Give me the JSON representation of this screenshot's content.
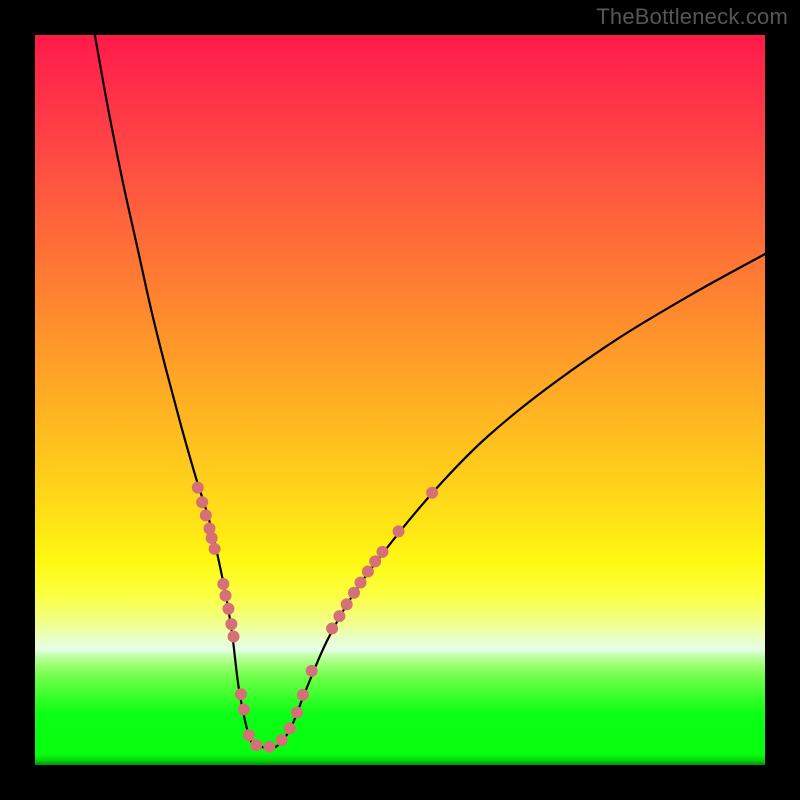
{
  "watermark": "TheBottleneck.com",
  "colors": {
    "background": "#000000",
    "curve": "#000000",
    "marker": "#d67077",
    "gradient_top": "#ff1a4a",
    "gradient_bottom": "#028e08"
  },
  "chart_data": {
    "type": "line",
    "title": "",
    "xlabel": "",
    "ylabel": "",
    "xlim": [
      0,
      100
    ],
    "ylim": [
      0,
      100
    ],
    "grid": false,
    "legend": false,
    "series": [
      {
        "name": "curve",
        "x": [
          8.2,
          10.0,
          12.0,
          14.0,
          16.0,
          18.0,
          20.0,
          22.0,
          24.0,
          26.0,
          27.0,
          28.0,
          29.5,
          31.0,
          33.0,
          35.0,
          37.0,
          40.0,
          44.0,
          50.0,
          56.0,
          62.0,
          70.0,
          80.0,
          90.0,
          100.0
        ],
        "y": [
          100.0,
          90.0,
          80.0,
          71.0,
          62.0,
          54.0,
          46.5,
          39.5,
          33.0,
          24.0,
          18.0,
          10.0,
          3.5,
          2.5,
          2.5,
          5.0,
          10.0,
          17.0,
          24.0,
          32.0,
          39.0,
          45.0,
          51.5,
          58.5,
          64.5,
          70.0
        ]
      }
    ],
    "markers": [
      {
        "x": 22.3,
        "y": 38.0,
        "size": 6
      },
      {
        "x": 22.9,
        "y": 36.0,
        "size": 6
      },
      {
        "x": 23.4,
        "y": 34.2,
        "size": 6
      },
      {
        "x": 23.9,
        "y": 32.4,
        "size": 6
      },
      {
        "x": 24.2,
        "y": 31.1,
        "size": 6
      },
      {
        "x": 24.6,
        "y": 29.6,
        "size": 6
      },
      {
        "x": 25.8,
        "y": 24.8,
        "size": 6
      },
      {
        "x": 26.1,
        "y": 23.2,
        "size": 6
      },
      {
        "x": 26.5,
        "y": 21.4,
        "size": 6
      },
      {
        "x": 26.9,
        "y": 19.3,
        "size": 6
      },
      {
        "x": 27.2,
        "y": 17.6,
        "size": 6
      },
      {
        "x": 28.2,
        "y": 9.7,
        "size": 6
      },
      {
        "x": 28.6,
        "y": 7.6,
        "size": 6
      },
      {
        "x": 29.3,
        "y": 4.1,
        "size": 6
      },
      {
        "x": 30.3,
        "y": 2.7,
        "size": 6
      },
      {
        "x": 32.1,
        "y": 2.5,
        "size": 6
      },
      {
        "x": 33.8,
        "y": 3.4,
        "size": 6
      },
      {
        "x": 34.9,
        "y": 5.0,
        "size": 6
      },
      {
        "x": 35.9,
        "y": 7.2,
        "size": 6
      },
      {
        "x": 36.7,
        "y": 9.6,
        "size": 6
      },
      {
        "x": 37.9,
        "y": 12.9,
        "size": 6
      },
      {
        "x": 40.7,
        "y": 18.7,
        "size": 6
      },
      {
        "x": 41.7,
        "y": 20.4,
        "size": 6
      },
      {
        "x": 42.7,
        "y": 22.0,
        "size": 6
      },
      {
        "x": 43.7,
        "y": 23.6,
        "size": 6
      },
      {
        "x": 44.6,
        "y": 25.0,
        "size": 6
      },
      {
        "x": 45.6,
        "y": 26.5,
        "size": 6
      },
      {
        "x": 46.6,
        "y": 27.9,
        "size": 6
      },
      {
        "x": 47.6,
        "y": 29.2,
        "size": 6
      },
      {
        "x": 49.8,
        "y": 32.0,
        "size": 6
      },
      {
        "x": 54.4,
        "y": 37.3,
        "size": 6
      }
    ]
  }
}
